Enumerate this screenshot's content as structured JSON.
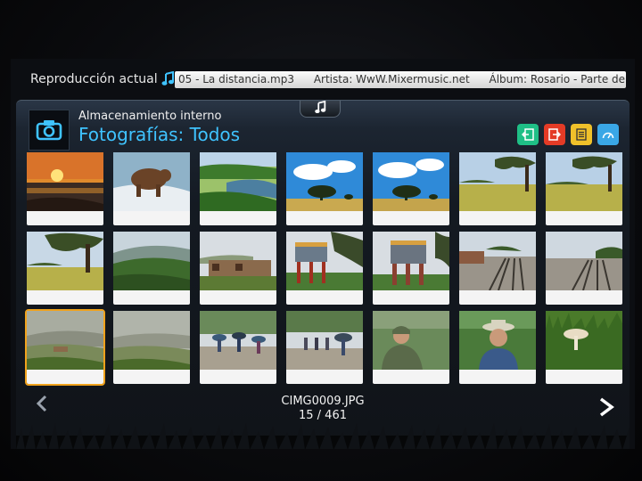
{
  "now_playing": {
    "label": "Reproducción actual",
    "track": "05 - La distancia.mp3",
    "artist": "Artista: WwW.Mixermusic.net",
    "album": "Álbum: Rosario - Parte de mi"
  },
  "header": {
    "source": "Almacenamiento interno",
    "view_title": "Fotografías: Todos"
  },
  "control_buttons": [
    {
      "name": "back-button",
      "color": "#1fbf86"
    },
    {
      "name": "exit-button",
      "color": "#e43b26"
    },
    {
      "name": "menu-button",
      "color": "#f0c12a"
    },
    {
      "name": "info-button",
      "color": "#3aa7e6"
    }
  ],
  "photos": [
    {
      "scene": "sunset-beach"
    },
    {
      "scene": "bear-river"
    },
    {
      "scene": "green-hills-lake"
    },
    {
      "scene": "tree-blue-sky-1"
    },
    {
      "scene": "tree-blue-sky-2"
    },
    {
      "scene": "oak-field-1"
    },
    {
      "scene": "oak-field-2"
    },
    {
      "scene": "oak-meadow"
    },
    {
      "scene": "forest-mountains"
    },
    {
      "scene": "stone-ruins"
    },
    {
      "scene": "water-tower-1"
    },
    {
      "scene": "water-tower-2"
    },
    {
      "scene": "railway-station-1"
    },
    {
      "scene": "railway-station-2"
    },
    {
      "scene": "foggy-hills-1"
    },
    {
      "scene": "foggy-hills-2"
    },
    {
      "scene": "hikers-umbrellas-1"
    },
    {
      "scene": "hikers-umbrellas-2"
    },
    {
      "scene": "man-rain-jacket"
    },
    {
      "scene": "man-hat"
    },
    {
      "scene": "mushroom-grass"
    }
  ],
  "selection": {
    "index": 15,
    "total": 461,
    "filename": "CIMG0009.JPG",
    "counter": "15 / 461"
  },
  "colors": {
    "accent": "#3fc3ff",
    "selection": "#f0a21c"
  }
}
